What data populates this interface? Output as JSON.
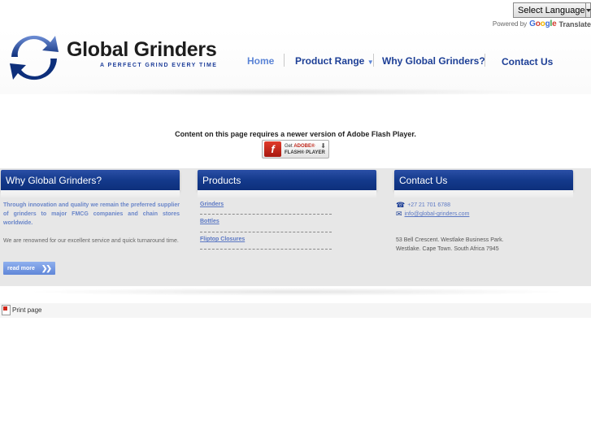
{
  "translate": {
    "select_label": "Select Language",
    "powered_by": "Powered by",
    "google": [
      "G",
      "o",
      "o",
      "g",
      "l",
      "e"
    ],
    "translate_label": "Translate"
  },
  "brand": {
    "name": "Global Grinders",
    "tagline": "A PERFECT GRIND EVERY TIME",
    "logo_colors": {
      "dark": "#0d2f7b",
      "light": "#6f8fd6"
    }
  },
  "nav": {
    "home": "Home",
    "product_range": "Product Range",
    "why": "Why Global Grinders?",
    "contact": "Contact Us",
    "colors": {
      "home": "#5b84d6",
      "others": "#1d3f96"
    }
  },
  "flash": {
    "message": "Content on this page requires a newer version of Adobe Flash Player.",
    "badge_get": "Get",
    "badge_adobe": "ADOBE®",
    "badge_product": "FLASH® PLAYER",
    "icon_letter": "f"
  },
  "panels": {
    "why": {
      "title": "Why Global Grinders?",
      "para1": "Through innovation and quality we remain the preferred supplier of grinders to major FMCG companies and chain stores worldwide.",
      "para2": "We are renowned for our excellent service and quick turnaround time.",
      "read_more": "read more"
    },
    "products": {
      "title": "Products",
      "items": [
        "Grinders",
        "Bottles",
        "Fliptop Closures"
      ]
    },
    "contact": {
      "title": "Contact Us",
      "phone": "+27 21 701 6788",
      "email": "info@global-grinders.com",
      "address_line1": "53 Bell Crescent. Westlake Business Park.",
      "address_line2": "Westlake. Cape Town. South Africa 7945"
    }
  },
  "footer": {
    "print": "Print page"
  },
  "icons": {
    "phone": "phone-icon",
    "email": "envelope-icon",
    "pdf": "pdf-icon",
    "chevron": "chevron-down-icon"
  }
}
